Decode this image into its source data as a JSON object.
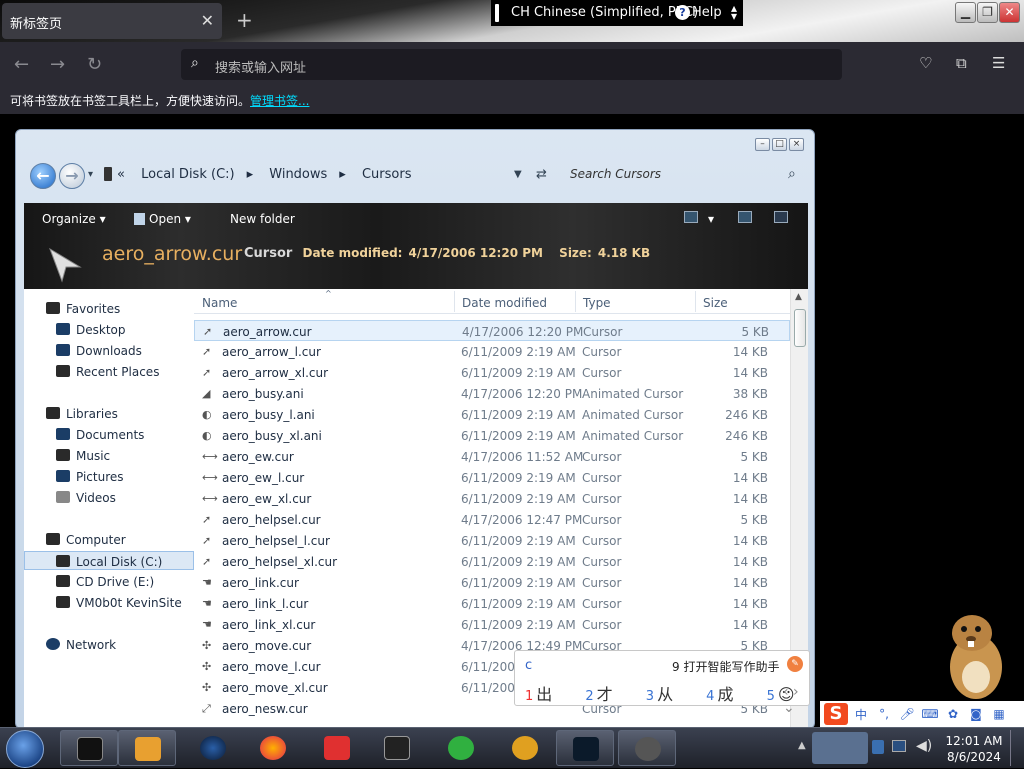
{
  "browser": {
    "tab_title": "新标签页",
    "tab_close": "✕",
    "new_tab": "+",
    "url_placeholder": "搜索或输入网址",
    "bookmark_hint": "可将书签放在书签工具栏上，方便快速访问。",
    "bookmark_link": "管理书签..."
  },
  "ime_langbar": {
    "language": "CH Chinese (Simplified, PRC)",
    "help": "Help"
  },
  "explorer": {
    "breadcrumb": [
      "Local Disk (C:)",
      "Windows",
      "Cursors"
    ],
    "search_placeholder": "Search Cursors",
    "toolbar": {
      "organize": "Organize",
      "open": "Open",
      "new_folder": "New folder"
    },
    "details": {
      "filename": "aero_arrow.cur",
      "type": "Cursor",
      "date_label": "Date modified:",
      "date": "4/17/2006 12:20 PM",
      "size_label": "Size:",
      "size": "4.18 KB"
    },
    "nav": {
      "favorites": "Favorites",
      "desktop": "Desktop",
      "downloads": "Downloads",
      "recent_places": "Recent Places",
      "libraries": "Libraries",
      "documents": "Documents",
      "music": "Music",
      "pictures": "Pictures",
      "videos": "Videos",
      "computer": "Computer",
      "local_disk": "Local Disk (C:)",
      "cd_drive": "CD Drive (E:)",
      "vm": "VM0b0t KevinSite",
      "network": "Network"
    },
    "columns": {
      "name": "Name",
      "date": "Date modified",
      "type": "Type",
      "size": "Size"
    },
    "files": [
      {
        "name": "aero_arrow.cur",
        "date": "4/17/2006 12:20 PM",
        "type": "Cursor",
        "size": "5 KB"
      },
      {
        "name": "aero_arrow_l.cur",
        "date": "6/11/2009 2:19 AM",
        "type": "Cursor",
        "size": "14 KB"
      },
      {
        "name": "aero_arrow_xl.cur",
        "date": "6/11/2009 2:19 AM",
        "type": "Cursor",
        "size": "14 KB"
      },
      {
        "name": "aero_busy.ani",
        "date": "4/17/2006 12:20 PM",
        "type": "Animated Cursor",
        "size": "38 KB"
      },
      {
        "name": "aero_busy_l.ani",
        "date": "6/11/2009 2:19 AM",
        "type": "Animated Cursor",
        "size": "246 KB"
      },
      {
        "name": "aero_busy_xl.ani",
        "date": "6/11/2009 2:19 AM",
        "type": "Animated Cursor",
        "size": "246 KB"
      },
      {
        "name": "aero_ew.cur",
        "date": "4/17/2006 11:52 AM",
        "type": "Cursor",
        "size": "5 KB"
      },
      {
        "name": "aero_ew_l.cur",
        "date": "6/11/2009 2:19 AM",
        "type": "Cursor",
        "size": "14 KB"
      },
      {
        "name": "aero_ew_xl.cur",
        "date": "6/11/2009 2:19 AM",
        "type": "Cursor",
        "size": "14 KB"
      },
      {
        "name": "aero_helpsel.cur",
        "date": "4/17/2006 12:47 PM",
        "type": "Cursor",
        "size": "5 KB"
      },
      {
        "name": "aero_helpsel_l.cur",
        "date": "6/11/2009 2:19 AM",
        "type": "Cursor",
        "size": "14 KB"
      },
      {
        "name": "aero_helpsel_xl.cur",
        "date": "6/11/2009 2:19 AM",
        "type": "Cursor",
        "size": "14 KB"
      },
      {
        "name": "aero_link.cur",
        "date": "6/11/2009 2:19 AM",
        "type": "Cursor",
        "size": "14 KB"
      },
      {
        "name": "aero_link_l.cur",
        "date": "6/11/2009 2:19 AM",
        "type": "Cursor",
        "size": "14 KB"
      },
      {
        "name": "aero_link_xl.cur",
        "date": "6/11/2009 2:19 AM",
        "type": "Cursor",
        "size": "14 KB"
      },
      {
        "name": "aero_move.cur",
        "date": "4/17/2006 12:49 PM",
        "type": "Cursor",
        "size": "5 KB"
      },
      {
        "name": "aero_move_l.cur",
        "date": "6/11/2009",
        "type": "",
        "size": ""
      },
      {
        "name": "aero_move_xl.cur",
        "date": "6/11/2009",
        "type": "",
        "size": ""
      },
      {
        "name": "aero_nesw.cur",
        "date": "",
        "type": "Cursor",
        "size": "5 KB"
      }
    ]
  },
  "ime_popup": {
    "input": "c",
    "assist_num": "9",
    "assist": "打开智能写作助手",
    "candidates": [
      {
        "num": "1",
        "text": "出"
      },
      {
        "num": "2",
        "text": "才"
      },
      {
        "num": "3",
        "text": "从"
      },
      {
        "num": "4",
        "text": "成"
      },
      {
        "num": "5",
        "text": ""
      }
    ]
  },
  "sogou": {
    "logo": "S",
    "mode": "中"
  },
  "clock": {
    "time": "12:01 AM",
    "date": "8/6/2024"
  },
  "colors": {
    "accent_link": "#00ddff",
    "details_text": "#e8b060",
    "ime_candidate_number": "#f03030"
  }
}
